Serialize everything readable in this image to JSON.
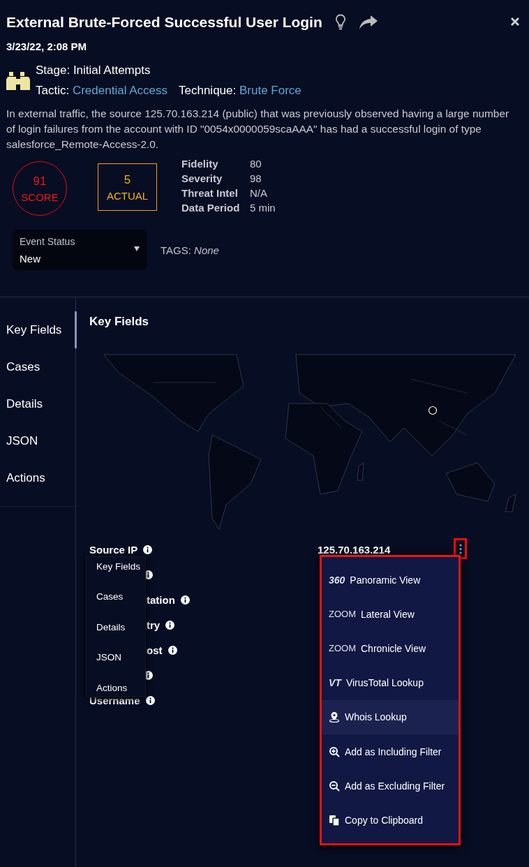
{
  "header": {
    "title": "External Brute-Forced Successful User Login",
    "timestamp": "3/23/22, 2:08 PM",
    "stage": {
      "label": "Stage:",
      "value": "Initial Attempts"
    },
    "tactic": {
      "label": "Tactic:",
      "value": "Credential Access"
    },
    "technique": {
      "label": "Technique:",
      "value": "Brute Force"
    },
    "description": "In external traffic, the source 125.70.163.214 (public) that was previously observed having a large number of login failures from the account with ID \"0054x0000059scaAAA\" has had a successful login of type salesforce_Remote-Access-2.0.",
    "score": {
      "value": "91",
      "label": "SCORE"
    },
    "actual": {
      "value": "5",
      "label": "ACTUAL"
    },
    "metrics": [
      {
        "label": "Fidelity",
        "value": "80"
      },
      {
        "label": "Severity",
        "value": "98"
      },
      {
        "label": "Threat Intel",
        "value": "N/A"
      },
      {
        "label": "Data Period",
        "value": "5 min"
      }
    ],
    "event_status": {
      "label": "Event Status",
      "value": "New"
    },
    "tags": {
      "label": "TAGS:",
      "value": "None"
    }
  },
  "tabs": [
    {
      "label": "Key Fields",
      "selected": true
    },
    {
      "label": "Cases",
      "selected": false
    },
    {
      "label": "Details",
      "selected": false
    },
    {
      "label": "JSON",
      "selected": false
    },
    {
      "label": "Actions",
      "selected": false
    }
  ],
  "panel_title": "Key Fields",
  "fields": [
    {
      "kind": "labeled",
      "label": "Source IP",
      "value": "125.70.163.214"
    },
    {
      "kind": "icon-only"
    },
    {
      "kind": "labeled",
      "label": "tation"
    },
    {
      "kind": "labeled",
      "label": "try"
    },
    {
      "kind": "labeled",
      "label": "ost"
    },
    {
      "kind": "icon-only"
    },
    {
      "kind": "labeled",
      "label": "Username"
    }
  ],
  "tab_popup": [
    "Key Fields",
    "Cases",
    "Details",
    "JSON",
    "Actions"
  ],
  "actions_menu": [
    {
      "kind": "badge",
      "badge": "360",
      "label": "Panoramic View",
      "selected": false
    },
    {
      "kind": "badge",
      "badge": "ZOOM",
      "label": "Lateral View",
      "selected": false
    },
    {
      "kind": "badge",
      "badge": "ZOOM",
      "label": "Chronicle View",
      "selected": false
    },
    {
      "kind": "badge",
      "badge": "VT",
      "label": "VirusTotal Lookup",
      "selected": false
    },
    {
      "kind": "pin",
      "label": "Whois Lookup",
      "selected": true
    },
    {
      "kind": "zoom-in",
      "label": "Add as Including Filter",
      "selected": false
    },
    {
      "kind": "zoom-out",
      "label": "Add as Excluding Filter",
      "selected": false
    },
    {
      "kind": "copy",
      "label": "Copy to Clipboard",
      "selected": false
    }
  ]
}
